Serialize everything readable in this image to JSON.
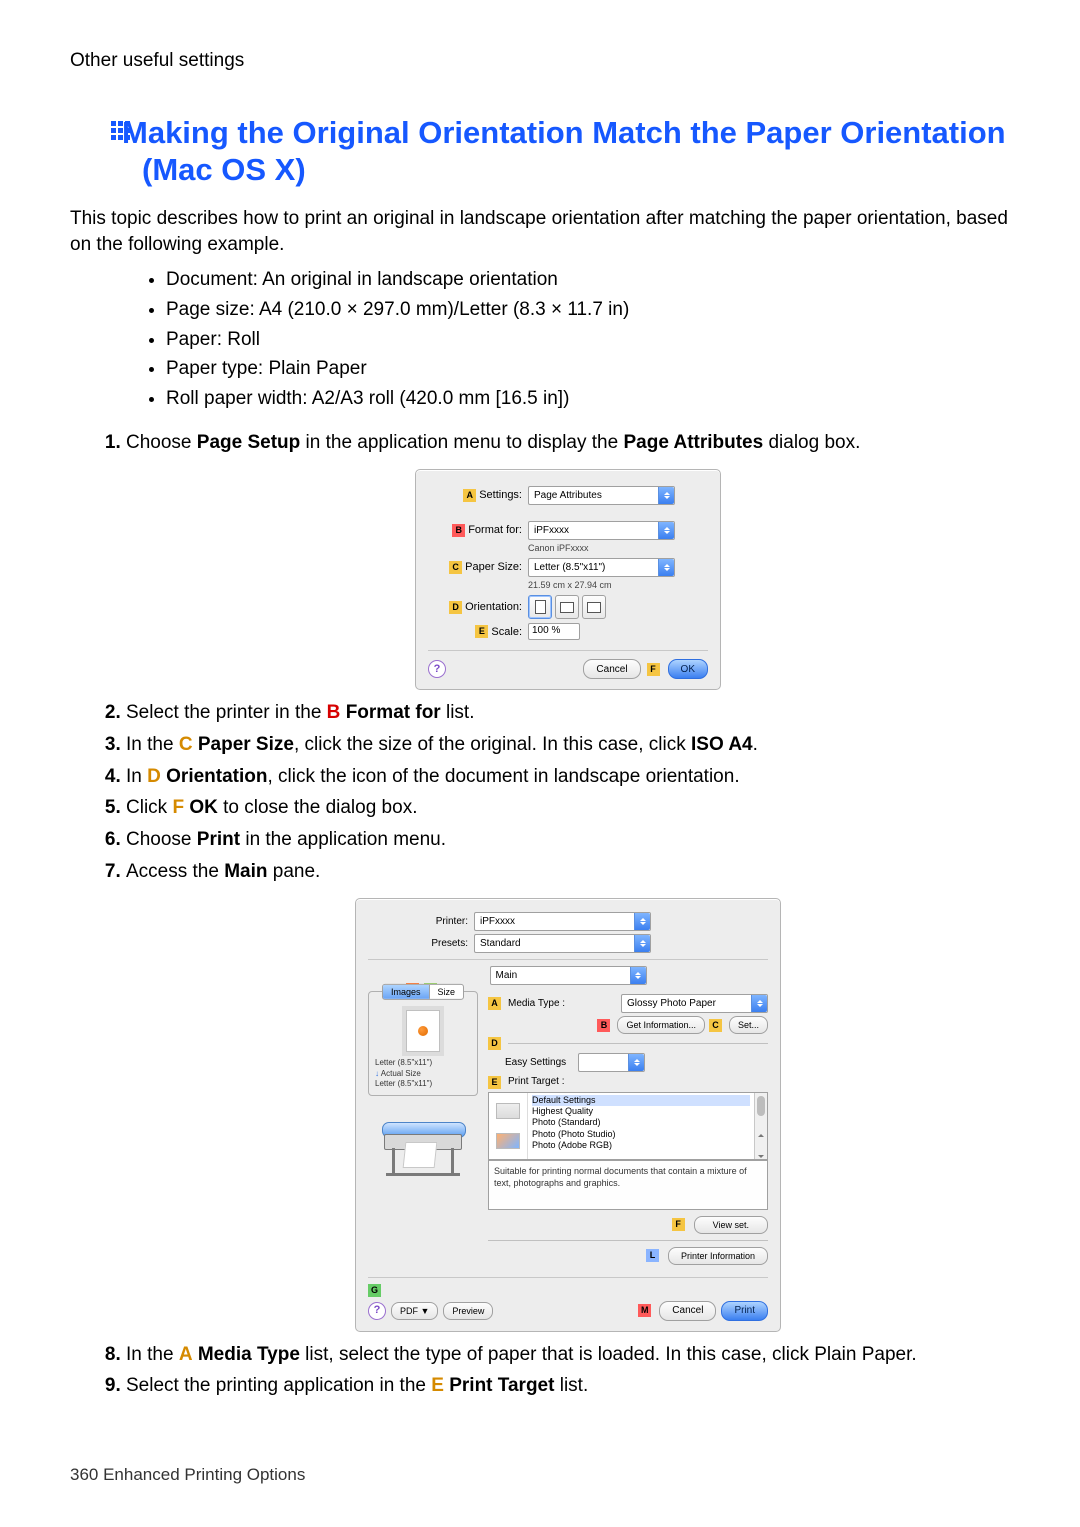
{
  "header_path": "Other useful settings",
  "title": "Making the Original Orientation Match the Paper Orientation (Mac OS X)",
  "intro": "This topic describes how to print an original in landscape orientation after matching the paper orientation, based on the following example.",
  "bullets": [
    "Document: An original in landscape orientation",
    "Page size: A4 (210.0 × 297.0 mm)/Letter (8.3 × 11.7 in)",
    "Paper: Roll",
    "Paper type: Plain Paper",
    "Roll paper width: A2/A3 roll (420.0 mm [16.5 in])"
  ],
  "steps": {
    "s1_a": "Choose ",
    "s1_b": " in the application menu to display the ",
    "s1_c": " dialog box.",
    "s1_k1": "Page Setup",
    "s1_k2": "Page Attributes",
    "s2_a": "Select the printer in the ",
    "s2_b": " list.",
    "s2_tag": "B",
    "s2_k": "Format for",
    "s3_a": "In the ",
    "s3_b": ", click the size of the original. In this case, click ",
    "s3_c": ".",
    "s3_tag": "C",
    "s3_k1": "Paper Size",
    "s3_k2": "ISO A4",
    "s4_a": "In ",
    "s4_b": ", click the icon of the document in landscape orientation.",
    "s4_tag": "D",
    "s4_k": "Orientation",
    "s5_a": "Click ",
    "s5_b": " to close the dialog box.",
    "s5_tag": "F",
    "s5_k": "OK",
    "s6_a": "Choose ",
    "s6_b": " in the application menu.",
    "s6_k": "Print",
    "s7_a": "Access the ",
    "s7_b": " pane.",
    "s7_k": "Main",
    "s8_a": "In the ",
    "s8_b": " list, select the type of paper that is loaded. In this case, click Plain Paper.",
    "s8_tag": "A",
    "s8_k": "Media Type",
    "s9_a": "Select the printing application in the ",
    "s9_b": " list.",
    "s9_tag": "E",
    "s9_k": "Print Target"
  },
  "dlg1": {
    "rows": {
      "settings_lab": "Settings:",
      "settings_val": "Page Attributes",
      "format_lab": "Format for:",
      "format_val": "iPFxxxx",
      "format_sub": "Canon iPFxxxx",
      "size_lab": "Paper Size:",
      "size_val": "Letter (8.5\"x11\")",
      "size_sub": "21.59 cm x 27.94 cm",
      "orient_lab": "Orientation:",
      "scale_lab": "Scale:",
      "scale_val": "100 %"
    },
    "btn_cancel": "Cancel",
    "btn_ok": "OK",
    "tags": {
      "A": "A",
      "B": "B",
      "C": "C",
      "D": "D",
      "E": "E",
      "F": "F"
    }
  },
  "dlg2": {
    "printer_lab": "Printer:",
    "printer_val": "iPFxxxx",
    "presets_lab": "Presets:",
    "presets_val": "Standard",
    "pane_val": "Main",
    "tab_images": "Images",
    "tab_size": "Size",
    "left_line1": "Letter (8.5\"x11\")",
    "left_line2": "Actual Size",
    "left_line3": "Letter (8.5\"x11\")",
    "media_lab": "Media Type :",
    "media_val": "Glossy Photo Paper",
    "getinfo": "Get Information...",
    "set": "Set...",
    "easy_lab": "Easy Settings",
    "target_lab": "Print Target :",
    "target_opts": [
      "Default Settings",
      "Highest Quality",
      "Photo (Standard)",
      "Photo (Photo Studio)",
      "Photo (Adobe RGB)"
    ],
    "desc": "Suitable for printing normal documents that contain a mixture of text, photographs and graphics.",
    "view_set": "View set.",
    "printer_info": "Printer Information",
    "pdf": "PDF ▼",
    "preview": "Preview",
    "cancel": "Cancel",
    "print": "Print",
    "tags": {
      "A": "A",
      "B": "B",
      "C": "C",
      "D": "D",
      "E": "E",
      "F": "F",
      "G": "G",
      "H": "H",
      "I": "I",
      "L": "L",
      "M": "M"
    }
  },
  "footer": "360  Enhanced Printing Options"
}
